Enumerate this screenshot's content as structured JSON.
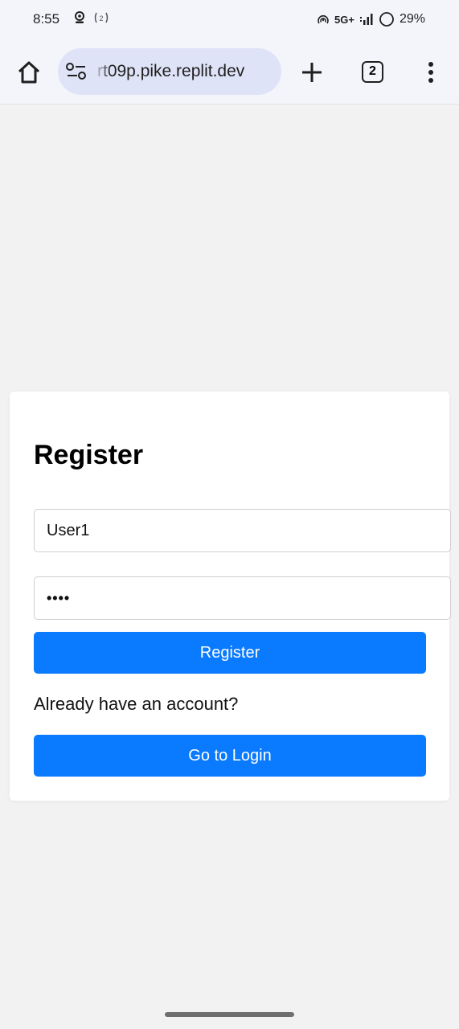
{
  "status_bar": {
    "time": "8:55",
    "network": "5G+",
    "battery": "29%"
  },
  "browser": {
    "url": "rt09p.pike.replit.dev",
    "tab_count": "2"
  },
  "form": {
    "title": "Register",
    "username_value": "User1",
    "password_value": "••••",
    "register_label": "Register",
    "account_prompt": "Already have an account?",
    "login_label": "Go to Login"
  },
  "colors": {
    "primary": "#0a7afe",
    "background": "#f2f2f2"
  }
}
